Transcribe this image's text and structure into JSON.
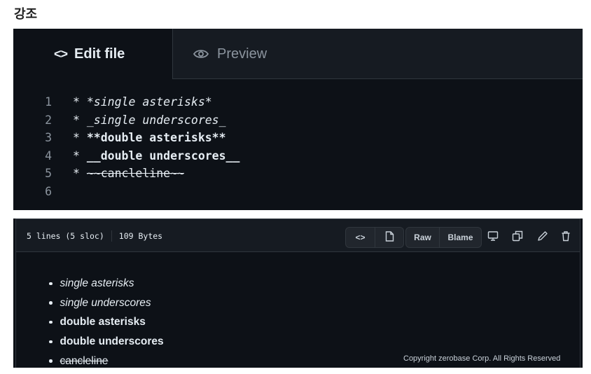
{
  "heading": "강조",
  "editor": {
    "tabs": {
      "edit_icon": "<>",
      "edit_label": "Edit file",
      "preview_label": "Preview",
      "preview_icon": "eye-icon"
    },
    "lines": [
      {
        "num": "1",
        "marker": "* ",
        "text": "*single asterisks*",
        "style": "italic"
      },
      {
        "num": "2",
        "marker": "* ",
        "text": "_single underscores_",
        "style": "italic"
      },
      {
        "num": "3",
        "marker": "* ",
        "text": "**double asterisks**",
        "style": "bold"
      },
      {
        "num": "4",
        "marker": "* ",
        "text": "__double underscores__",
        "style": "bold"
      },
      {
        "num": "5",
        "marker": "* ",
        "text": "~~cancleline~~",
        "style": "strike"
      },
      {
        "num": "6",
        "marker": "",
        "text": "",
        "style": "normal"
      }
    ]
  },
  "viewer": {
    "lines_info": "5 lines (5 sloc)",
    "size_info": "109 Bytes",
    "code_view_icon": "<>",
    "raw_label": "Raw",
    "blame_label": "Blame",
    "items": [
      {
        "text": "single asterisks",
        "style": "italic"
      },
      {
        "text": "single underscores",
        "style": "italic"
      },
      {
        "text": "double asterisks",
        "style": "bold"
      },
      {
        "text": "double underscores",
        "style": "bold"
      },
      {
        "text": "cancleline",
        "style": "strike"
      }
    ]
  },
  "copyright": "Copyright zerobase Corp. All Rights Reserved",
  "colors": {
    "background": "#0d1117",
    "header": "#161b22",
    "text": "#e6edf3",
    "muted": "#8b949e",
    "border": "#30363d"
  }
}
